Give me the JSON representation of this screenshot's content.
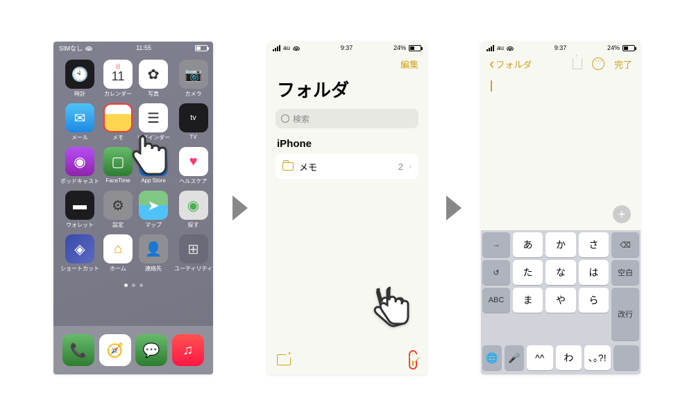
{
  "screen1": {
    "status": {
      "carrier": "SIMなし",
      "time": "11:55"
    },
    "apps": [
      {
        "label": "時計",
        "bg": "#1c1c1e",
        "glyph": "🕙"
      },
      {
        "label": "カレンダー",
        "bg": "#fff",
        "glyph": "11",
        "top": "日"
      },
      {
        "label": "写真",
        "bg": "#fff",
        "glyph": "✿"
      },
      {
        "label": "カメラ",
        "bg": "#8e8e93",
        "glyph": "📷"
      },
      {
        "label": "メール",
        "bg": "linear-gradient(#4fc3f7,#1e88e5)",
        "glyph": "✉︎",
        "color": "#fff"
      },
      {
        "label": "メモ",
        "bg": "linear-gradient(#fff 35%,#ffd54f 35%)",
        "glyph": "",
        "hl": true
      },
      {
        "label": "リマインダー",
        "bg": "#fff",
        "glyph": "☰"
      },
      {
        "label": "TV",
        "bg": "#1c1c1e",
        "glyph": "tv",
        "color": "#fff",
        "font": "11px"
      },
      {
        "label": "ポッドキャスト",
        "bg": "linear-gradient(#b74df5,#8e24aa)",
        "glyph": "◉",
        "color": "#fff"
      },
      {
        "label": "FaceTime",
        "bg": "linear-gradient(#66bb6a,#2e7d32)",
        "glyph": "▢",
        "color": "#fff"
      },
      {
        "label": "App Store",
        "bg": "linear-gradient(#42a5f5,#1565c0)",
        "glyph": "A",
        "color": "#fff"
      },
      {
        "label": "ヘルスケア",
        "bg": "#fff",
        "glyph": "♥",
        "color": "#ff3b6f"
      },
      {
        "label": "ウォレット",
        "bg": "#1c1c1e",
        "glyph": "▬",
        "color": "#fff"
      },
      {
        "label": "設定",
        "bg": "#8e8e93",
        "glyph": "⚙"
      },
      {
        "label": "マップ",
        "bg": "linear-gradient(#81c784 50%,#4fc3f7 50%)",
        "glyph": "➤",
        "color": "#fff"
      },
      {
        "label": "探す",
        "bg": "#e0e0e0",
        "glyph": "◉",
        "color": "#4caf50"
      },
      {
        "label": "ショートカット",
        "bg": "linear-gradient(135deg,#3949ab,#5c6bc0)",
        "glyph": "◈",
        "color": "#fff"
      },
      {
        "label": "ホーム",
        "bg": "#fff",
        "glyph": "⌂",
        "color": "#ff9800"
      },
      {
        "label": "連絡先",
        "bg": "#8e8e93",
        "glyph": "👤"
      },
      {
        "label": "ユーティリティ",
        "bg": "#6a6a78",
        "glyph": "⊞",
        "color": "#ddd"
      }
    ],
    "dock": [
      {
        "bg": "linear-gradient(#66bb6a,#2e7d32)",
        "glyph": "📞",
        "color": "#fff"
      },
      {
        "bg": "#fff",
        "glyph": "🧭"
      },
      {
        "bg": "linear-gradient(#66bb6a,#2e7d32)",
        "glyph": "💬",
        "color": "#fff"
      },
      {
        "bg": "linear-gradient(#ff5252,#ff1744)",
        "glyph": "♫",
        "color": "#fff"
      }
    ]
  },
  "screen2": {
    "status": {
      "carrier": "au",
      "time": "9:37",
      "battery": "24%"
    },
    "edit": "編集",
    "title": "フォルダ",
    "search": "検索",
    "section": "iPhone",
    "folder": {
      "name": "メモ",
      "count": "2"
    }
  },
  "screen3": {
    "status": {
      "carrier": "au",
      "time": "9:37",
      "battery": "24%"
    },
    "back": "フォルダ",
    "done": "完了",
    "keys": {
      "r1": [
        "→",
        "あ",
        "か",
        "さ",
        "⌫"
      ],
      "r2": [
        "↺",
        "た",
        "な",
        "は",
        "空白"
      ],
      "r3": [
        "ABC",
        "ま",
        "や",
        "ら",
        "改行"
      ],
      "r4": [
        "",
        "^^",
        "わ",
        "､｡?!",
        ""
      ],
      "globe": "🌐",
      "mic": "🎤"
    }
  }
}
